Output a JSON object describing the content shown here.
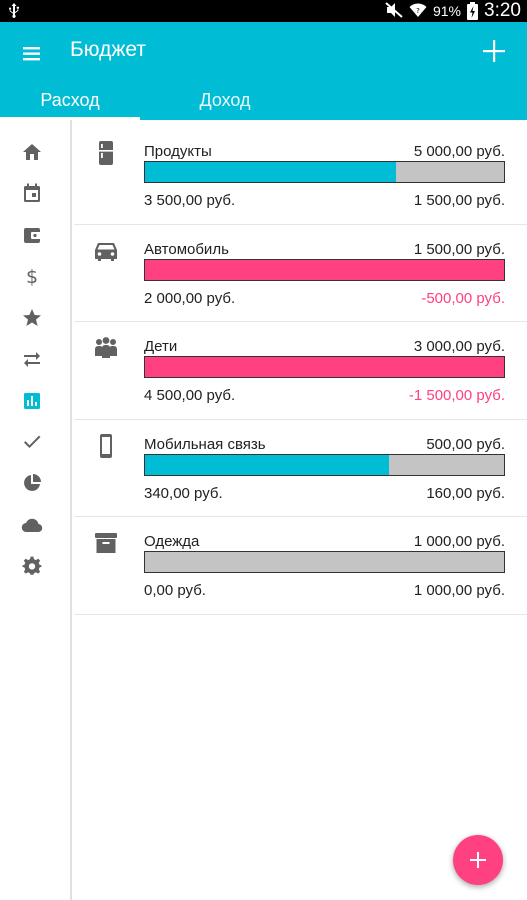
{
  "status_bar": {
    "battery": "91%",
    "time": "3:20",
    "icons": [
      "usb-icon",
      "mute-icon",
      "wifi-icon",
      "battery-charging-icon"
    ]
  },
  "app_bar": {
    "title": "Бюджет",
    "menu_icon": "menu-icon",
    "add_icon": "plus-icon",
    "color": "#00bcd4"
  },
  "tabs": [
    {
      "label": "Расход",
      "active": true
    },
    {
      "label": "Доход",
      "active": false
    }
  ],
  "sidebar": {
    "items": [
      {
        "icon": "home-icon"
      },
      {
        "icon": "calendar-icon"
      },
      {
        "icon": "wallet-icon"
      },
      {
        "icon": "dollar-icon"
      },
      {
        "icon": "star-icon"
      },
      {
        "icon": "transfer-icon"
      },
      {
        "icon": "bar-chart-icon",
        "active": true
      },
      {
        "icon": "check-icon"
      },
      {
        "icon": "pie-chart-icon"
      },
      {
        "icon": "cloud-icon"
      },
      {
        "icon": "settings-icon"
      }
    ],
    "active_color": "#00bcd4"
  },
  "budgets": [
    {
      "icon": "fridge-icon",
      "name": "Продукты",
      "budget": "5 000,00 руб.",
      "spent": "3 500,00 руб.",
      "remain": "1 500,00 руб.",
      "progress": 0.7,
      "over": false
    },
    {
      "icon": "car-icon",
      "name": "Автомобиль",
      "budget": "1 500,00 руб.",
      "spent": "2 000,00 руб.",
      "remain": "-500,00 руб.",
      "progress": 1.0,
      "over": true
    },
    {
      "icon": "people-icon",
      "name": "Дети",
      "budget": "3 000,00 руб.",
      "spent": "4 500,00 руб.",
      "remain": "-1 500,00 руб.",
      "progress": 1.0,
      "over": true
    },
    {
      "icon": "smartphone-icon",
      "name": "Мобильная связь",
      "budget": "500,00 руб.",
      "spent": "340,00 руб.",
      "remain": "160,00 руб.",
      "progress": 0.68,
      "over": false
    },
    {
      "icon": "archive-icon",
      "name": "Одежда",
      "budget": "1 000,00 руб.",
      "spent": "0,00 руб.",
      "remain": "1 000,00 руб.",
      "progress": 0.0,
      "over": false
    }
  ],
  "colors": {
    "progress_ok": "#00bcd4",
    "progress_over": "#ff4081",
    "negative_text": "#ff4081"
  },
  "fab": {
    "icon": "plus-icon",
    "color": "#ff4081"
  }
}
